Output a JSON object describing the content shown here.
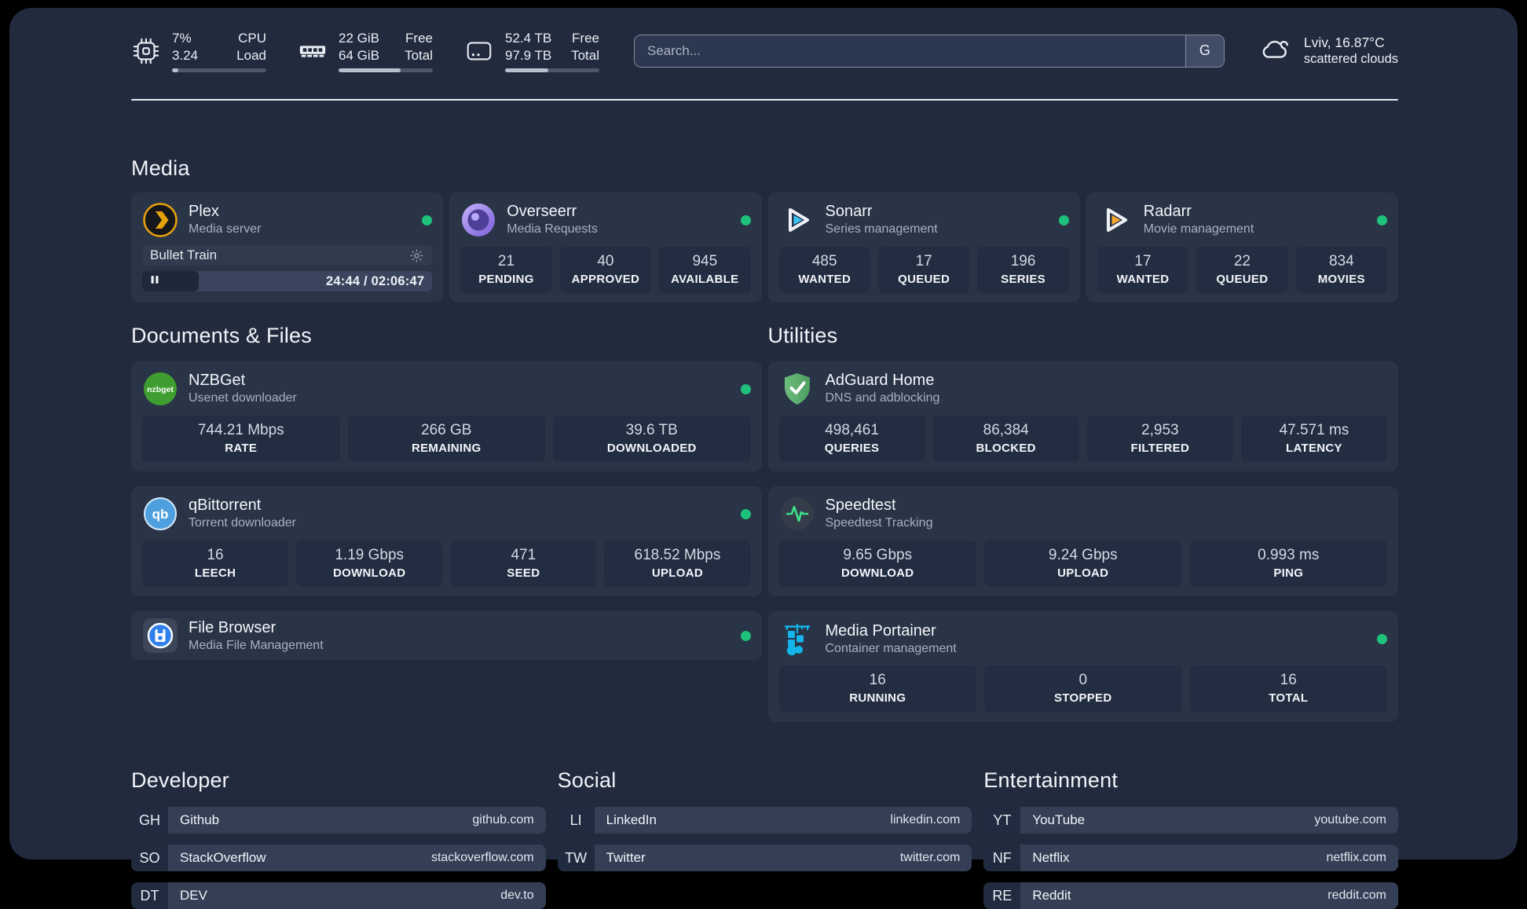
{
  "app": {
    "search_placeholder": "Search...",
    "search_engine": "G"
  },
  "colors": {
    "status_online": "#1ec27c",
    "plex_amber": "#e5a00d",
    "sonarr_blue": "#38c3f3",
    "radarr_orange": "#f6a62b",
    "portainer_blue": "#13b5ea",
    "adguard_green": "#5bab68",
    "speedtest_pulse": "#3ce287",
    "qbittorrent_blue": "#4e9fdd",
    "nzbget_green": "#3f9e2f",
    "filebrowser_blue": "#2f80ed"
  },
  "system_stats": [
    {
      "name": "cpu",
      "line1_value": "7%",
      "line2_value": "3.24",
      "line1_label": "CPU",
      "line2_label": "Load",
      "progress_pct": 7
    },
    {
      "name": "memory",
      "line1_value": "22 GiB",
      "line2_value": "64 GiB",
      "line1_label": "Free",
      "line2_label": "Total",
      "progress_pct": 66
    },
    {
      "name": "storage",
      "line1_value": "52.4 TB",
      "line2_value": "97.9 TB",
      "line1_label": "Free",
      "line2_label": "Total",
      "progress_pct": 46
    }
  ],
  "weather": {
    "location_temp": "Lviv, 16.87°C",
    "condition": "scattered clouds"
  },
  "sections": {
    "media": {
      "title": "Media",
      "plex": {
        "name": "Plex",
        "subtitle": "Media server",
        "now_playing": {
          "title": "Bullet Train",
          "time_text": "24:44 / 02:06:47",
          "progress_pct": 19.5
        }
      },
      "overseerr": {
        "name": "Overseerr",
        "subtitle": "Media Requests",
        "stats": [
          {
            "value": "21",
            "label": "PENDING"
          },
          {
            "value": "40",
            "label": "APPROVED"
          },
          {
            "value": "945",
            "label": "AVAILABLE"
          }
        ]
      },
      "sonarr": {
        "name": "Sonarr",
        "subtitle": "Series management",
        "stats": [
          {
            "value": "485",
            "label": "WANTED"
          },
          {
            "value": "17",
            "label": "QUEUED"
          },
          {
            "value": "196",
            "label": "SERIES"
          }
        ]
      },
      "radarr": {
        "name": "Radarr",
        "subtitle": "Movie management",
        "stats": [
          {
            "value": "17",
            "label": "WANTED"
          },
          {
            "value": "22",
            "label": "QUEUED"
          },
          {
            "value": "834",
            "label": "MOVIES"
          }
        ]
      }
    },
    "documents": {
      "title": "Documents & Files",
      "nzbget": {
        "name": "NZBGet",
        "subtitle": "Usenet downloader",
        "stats": [
          {
            "value": "744.21 Mbps",
            "label": "RATE"
          },
          {
            "value": "266 GB",
            "label": "REMAINING"
          },
          {
            "value": "39.6 TB",
            "label": "DOWNLOADED"
          }
        ]
      },
      "qbittorrent": {
        "name": "qBittorrent",
        "subtitle": "Torrent downloader",
        "stats": [
          {
            "value": "16",
            "label": "LEECH"
          },
          {
            "value": "1.19 Gbps",
            "label": "DOWNLOAD"
          },
          {
            "value": "471",
            "label": "SEED"
          },
          {
            "value": "618.52 Mbps",
            "label": "UPLOAD"
          }
        ]
      },
      "filebrowser": {
        "name": "File Browser",
        "subtitle": "Media File Management"
      }
    },
    "utilities": {
      "title": "Utilities",
      "adguard": {
        "name": "AdGuard Home",
        "subtitle": "DNS and adblocking",
        "stats": [
          {
            "value": "498,461",
            "label": "QUERIES"
          },
          {
            "value": "86,384",
            "label": "BLOCKED"
          },
          {
            "value": "2,953",
            "label": "FILTERED"
          },
          {
            "value": "47.571 ms",
            "label": "LATENCY"
          }
        ]
      },
      "speedtest": {
        "name": "Speedtest",
        "subtitle": "Speedtest Tracking",
        "stats": [
          {
            "value": "9.65 Gbps",
            "label": "DOWNLOAD"
          },
          {
            "value": "9.24 Gbps",
            "label": "UPLOAD"
          },
          {
            "value": "0.993 ms",
            "label": "PING"
          }
        ]
      },
      "portainer": {
        "name": "Media Portainer",
        "subtitle": "Container management",
        "stats": [
          {
            "value": "16",
            "label": "RUNNING"
          },
          {
            "value": "0",
            "label": "STOPPED"
          },
          {
            "value": "16",
            "label": "TOTAL"
          }
        ]
      }
    },
    "bookmarks": {
      "developer": {
        "title": "Developer",
        "items": [
          {
            "abbr": "GH",
            "name": "Github",
            "url": "github.com"
          },
          {
            "abbr": "SO",
            "name": "StackOverflow",
            "url": "stackoverflow.com"
          },
          {
            "abbr": "DT",
            "name": "DEV",
            "url": "dev.to"
          }
        ]
      },
      "social": {
        "title": "Social",
        "items": [
          {
            "abbr": "LI",
            "name": "LinkedIn",
            "url": "linkedin.com"
          },
          {
            "abbr": "TW",
            "name": "Twitter",
            "url": "twitter.com"
          }
        ]
      },
      "entertainment": {
        "title": "Entertainment",
        "items": [
          {
            "abbr": "YT",
            "name": "YouTube",
            "url": "youtube.com"
          },
          {
            "abbr": "NF",
            "name": "Netflix",
            "url": "netflix.com"
          },
          {
            "abbr": "RE",
            "name": "Reddit",
            "url": "reddit.com"
          }
        ]
      }
    }
  }
}
